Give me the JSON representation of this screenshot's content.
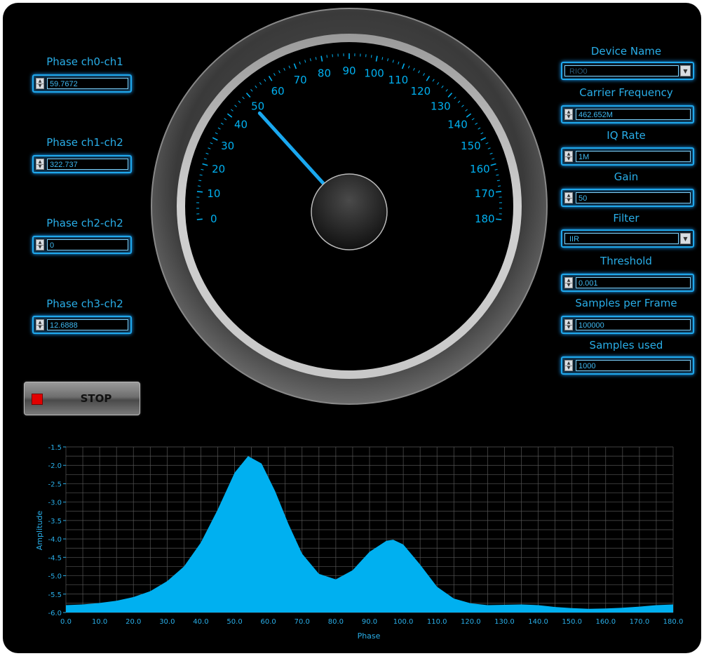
{
  "left_controls": [
    {
      "label": "Phase ch0-ch1",
      "value": "59.7672"
    },
    {
      "label": "Phase ch1-ch2",
      "value": "322.737"
    },
    {
      "label": "Phase ch2-ch2",
      "value": "0"
    },
    {
      "label": "Phase ch3-ch2",
      "value": "12.6888"
    }
  ],
  "right_controls": {
    "device_name": {
      "label": "Device Name",
      "value": "RIO0"
    },
    "carrier_frequency": {
      "label": "Carrier Frequency",
      "value": "462.652M"
    },
    "iq_rate": {
      "label": "IQ Rate",
      "value": "1M"
    },
    "gain": {
      "label": "Gain",
      "value": "50"
    },
    "filter": {
      "label": "Filter",
      "value": "IIR"
    },
    "threshold": {
      "label": "Threshold",
      "value": "0.001"
    },
    "samples_per_frame": {
      "label": "Samples per Frame",
      "value": "100000"
    },
    "samples_used": {
      "label": "Samples used",
      "value": "1000"
    }
  },
  "stop_button": {
    "label": "STOP"
  },
  "gauge": {
    "min": 0,
    "max": 180,
    "major_step": 10,
    "value": 50,
    "tick_labels": [
      "0",
      "10",
      "20",
      "30",
      "40",
      "50",
      "60",
      "70",
      "80",
      "90",
      "100",
      "110",
      "120",
      "130",
      "140",
      "150",
      "160",
      "170",
      "180"
    ]
  },
  "colors": {
    "accent": "#00b0f0",
    "label": "#29aee8",
    "panel": "#000000",
    "grid": "#555555"
  },
  "chart_data": {
    "type": "area",
    "xlabel": "Phase",
    "ylabel": "Amplitude",
    "xlim": [
      0,
      180
    ],
    "ylim": [
      -6.0,
      -1.5
    ],
    "x_ticks": [
      "0.0",
      "10.0",
      "20.0",
      "30.0",
      "40.0",
      "50.0",
      "60.0",
      "70.0",
      "80.0",
      "90.0",
      "100.0",
      "110.0",
      "120.0",
      "130.0",
      "140.0",
      "150.0",
      "160.0",
      "170.0",
      "180.0"
    ],
    "y_ticks": [
      "-1.5",
      "-2.0",
      "-2.5",
      "-3.0",
      "-3.5",
      "-4.0",
      "-4.5",
      "-5.0",
      "-5.5",
      "-6.0"
    ],
    "grid": true,
    "x": [
      0,
      5,
      10,
      15,
      20,
      25,
      30,
      35,
      40,
      45,
      50,
      54,
      58,
      62,
      66,
      70,
      75,
      80,
      85,
      90,
      95,
      97,
      100,
      105,
      110,
      115,
      120,
      125,
      130,
      135,
      140,
      145,
      150,
      155,
      160,
      165,
      170,
      175,
      180
    ],
    "y": [
      -5.8,
      -5.78,
      -5.74,
      -5.68,
      -5.58,
      -5.42,
      -5.15,
      -4.75,
      -4.1,
      -3.2,
      -2.2,
      -1.75,
      -1.95,
      -2.7,
      -3.6,
      -4.4,
      -4.95,
      -5.1,
      -4.85,
      -4.35,
      -4.05,
      -4.02,
      -4.15,
      -4.7,
      -5.3,
      -5.62,
      -5.75,
      -5.8,
      -5.79,
      -5.78,
      -5.8,
      -5.85,
      -5.88,
      -5.9,
      -5.89,
      -5.87,
      -5.84,
      -5.8,
      -5.78
    ]
  }
}
